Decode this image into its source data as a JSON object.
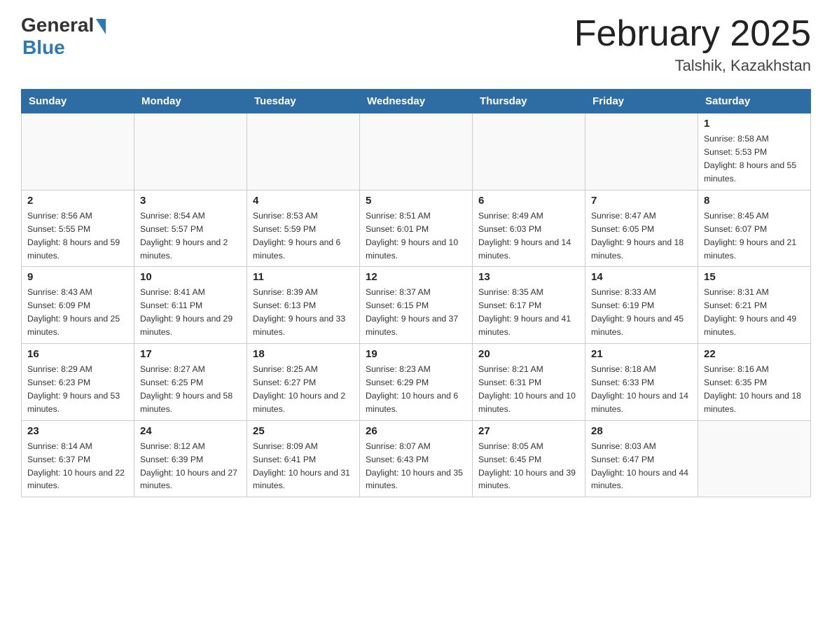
{
  "header": {
    "logo_general": "General",
    "logo_blue": "Blue",
    "title": "February 2025",
    "location": "Talshik, Kazakhstan"
  },
  "weekdays": [
    "Sunday",
    "Monday",
    "Tuesday",
    "Wednesday",
    "Thursday",
    "Friday",
    "Saturday"
  ],
  "weeks": [
    [
      {
        "day": "",
        "info": ""
      },
      {
        "day": "",
        "info": ""
      },
      {
        "day": "",
        "info": ""
      },
      {
        "day": "",
        "info": ""
      },
      {
        "day": "",
        "info": ""
      },
      {
        "day": "",
        "info": ""
      },
      {
        "day": "1",
        "info": "Sunrise: 8:58 AM\nSunset: 5:53 PM\nDaylight: 8 hours and 55 minutes."
      }
    ],
    [
      {
        "day": "2",
        "info": "Sunrise: 8:56 AM\nSunset: 5:55 PM\nDaylight: 8 hours and 59 minutes."
      },
      {
        "day": "3",
        "info": "Sunrise: 8:54 AM\nSunset: 5:57 PM\nDaylight: 9 hours and 2 minutes."
      },
      {
        "day": "4",
        "info": "Sunrise: 8:53 AM\nSunset: 5:59 PM\nDaylight: 9 hours and 6 minutes."
      },
      {
        "day": "5",
        "info": "Sunrise: 8:51 AM\nSunset: 6:01 PM\nDaylight: 9 hours and 10 minutes."
      },
      {
        "day": "6",
        "info": "Sunrise: 8:49 AM\nSunset: 6:03 PM\nDaylight: 9 hours and 14 minutes."
      },
      {
        "day": "7",
        "info": "Sunrise: 8:47 AM\nSunset: 6:05 PM\nDaylight: 9 hours and 18 minutes."
      },
      {
        "day": "8",
        "info": "Sunrise: 8:45 AM\nSunset: 6:07 PM\nDaylight: 9 hours and 21 minutes."
      }
    ],
    [
      {
        "day": "9",
        "info": "Sunrise: 8:43 AM\nSunset: 6:09 PM\nDaylight: 9 hours and 25 minutes."
      },
      {
        "day": "10",
        "info": "Sunrise: 8:41 AM\nSunset: 6:11 PM\nDaylight: 9 hours and 29 minutes."
      },
      {
        "day": "11",
        "info": "Sunrise: 8:39 AM\nSunset: 6:13 PM\nDaylight: 9 hours and 33 minutes."
      },
      {
        "day": "12",
        "info": "Sunrise: 8:37 AM\nSunset: 6:15 PM\nDaylight: 9 hours and 37 minutes."
      },
      {
        "day": "13",
        "info": "Sunrise: 8:35 AM\nSunset: 6:17 PM\nDaylight: 9 hours and 41 minutes."
      },
      {
        "day": "14",
        "info": "Sunrise: 8:33 AM\nSunset: 6:19 PM\nDaylight: 9 hours and 45 minutes."
      },
      {
        "day": "15",
        "info": "Sunrise: 8:31 AM\nSunset: 6:21 PM\nDaylight: 9 hours and 49 minutes."
      }
    ],
    [
      {
        "day": "16",
        "info": "Sunrise: 8:29 AM\nSunset: 6:23 PM\nDaylight: 9 hours and 53 minutes."
      },
      {
        "day": "17",
        "info": "Sunrise: 8:27 AM\nSunset: 6:25 PM\nDaylight: 9 hours and 58 minutes."
      },
      {
        "day": "18",
        "info": "Sunrise: 8:25 AM\nSunset: 6:27 PM\nDaylight: 10 hours and 2 minutes."
      },
      {
        "day": "19",
        "info": "Sunrise: 8:23 AM\nSunset: 6:29 PM\nDaylight: 10 hours and 6 minutes."
      },
      {
        "day": "20",
        "info": "Sunrise: 8:21 AM\nSunset: 6:31 PM\nDaylight: 10 hours and 10 minutes."
      },
      {
        "day": "21",
        "info": "Sunrise: 8:18 AM\nSunset: 6:33 PM\nDaylight: 10 hours and 14 minutes."
      },
      {
        "day": "22",
        "info": "Sunrise: 8:16 AM\nSunset: 6:35 PM\nDaylight: 10 hours and 18 minutes."
      }
    ],
    [
      {
        "day": "23",
        "info": "Sunrise: 8:14 AM\nSunset: 6:37 PM\nDaylight: 10 hours and 22 minutes."
      },
      {
        "day": "24",
        "info": "Sunrise: 8:12 AM\nSunset: 6:39 PM\nDaylight: 10 hours and 27 minutes."
      },
      {
        "day": "25",
        "info": "Sunrise: 8:09 AM\nSunset: 6:41 PM\nDaylight: 10 hours and 31 minutes."
      },
      {
        "day": "26",
        "info": "Sunrise: 8:07 AM\nSunset: 6:43 PM\nDaylight: 10 hours and 35 minutes."
      },
      {
        "day": "27",
        "info": "Sunrise: 8:05 AM\nSunset: 6:45 PM\nDaylight: 10 hours and 39 minutes."
      },
      {
        "day": "28",
        "info": "Sunrise: 8:03 AM\nSunset: 6:47 PM\nDaylight: 10 hours and 44 minutes."
      },
      {
        "day": "",
        "info": ""
      }
    ]
  ]
}
